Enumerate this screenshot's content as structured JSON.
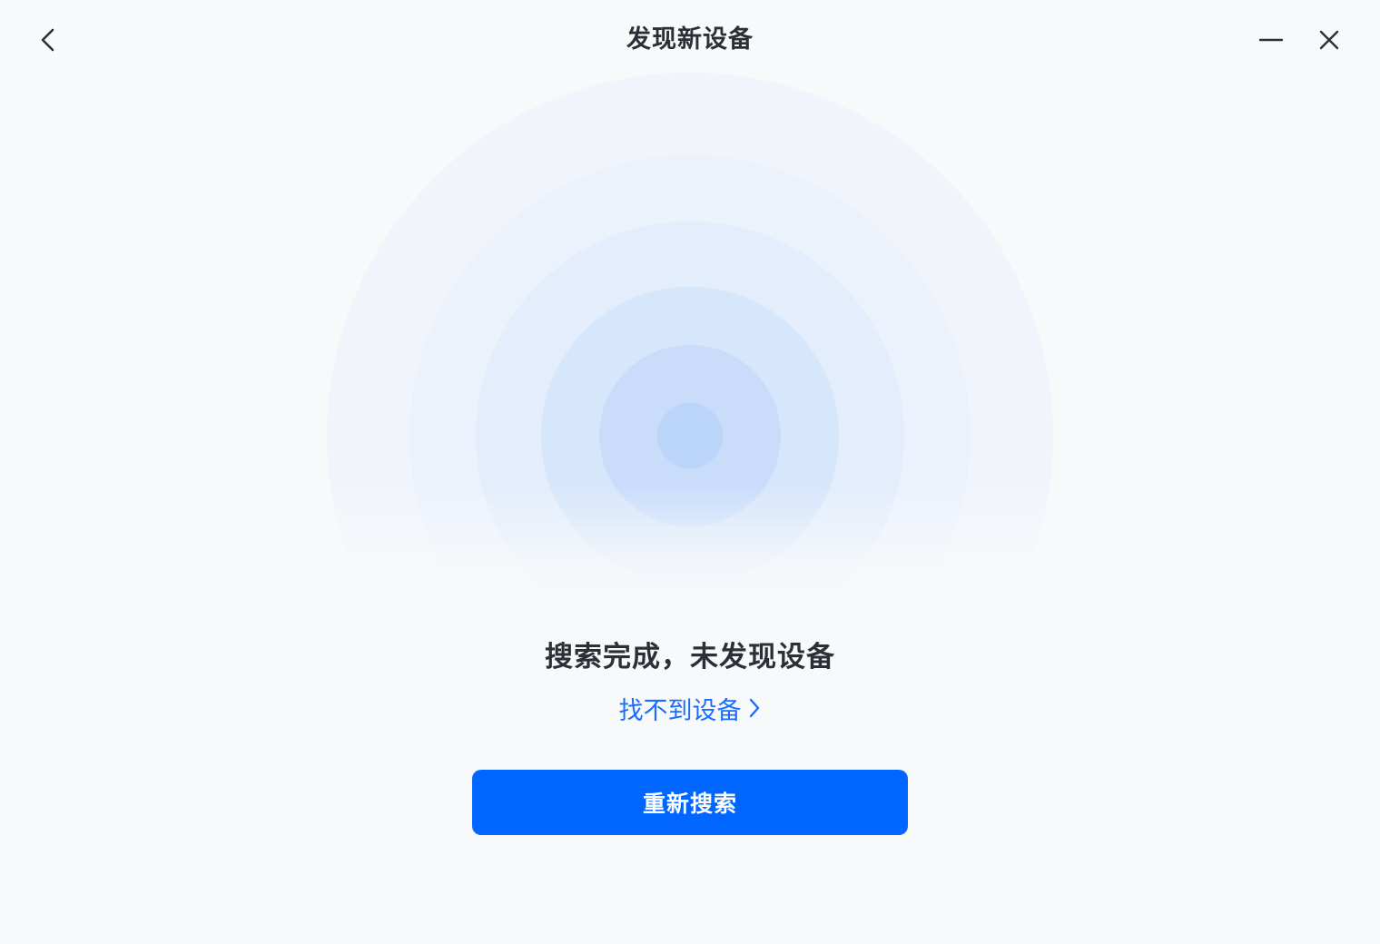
{
  "header": {
    "title": "发现新设备",
    "back_icon": "chevron-left-icon",
    "minimize_icon": "minimize-icon",
    "close_icon": "close-icon"
  },
  "radar": {
    "icon": "radar-search-illustration",
    "colors": [
      "#f1f5fb",
      "#ecf2fc",
      "#e3edfb",
      "#d6e6fb",
      "#c9ddfb",
      "#bcd5fb"
    ]
  },
  "status": {
    "message": "搜索完成，未发现设备",
    "help_link": "找不到设备",
    "help_icon": "chevron-right-icon"
  },
  "actions": {
    "rescan_label": "重新搜索"
  },
  "colors": {
    "background": "#f7f9fb",
    "accent": "#0066ff",
    "link": "#1a6dff",
    "text": "#2b2f36"
  }
}
